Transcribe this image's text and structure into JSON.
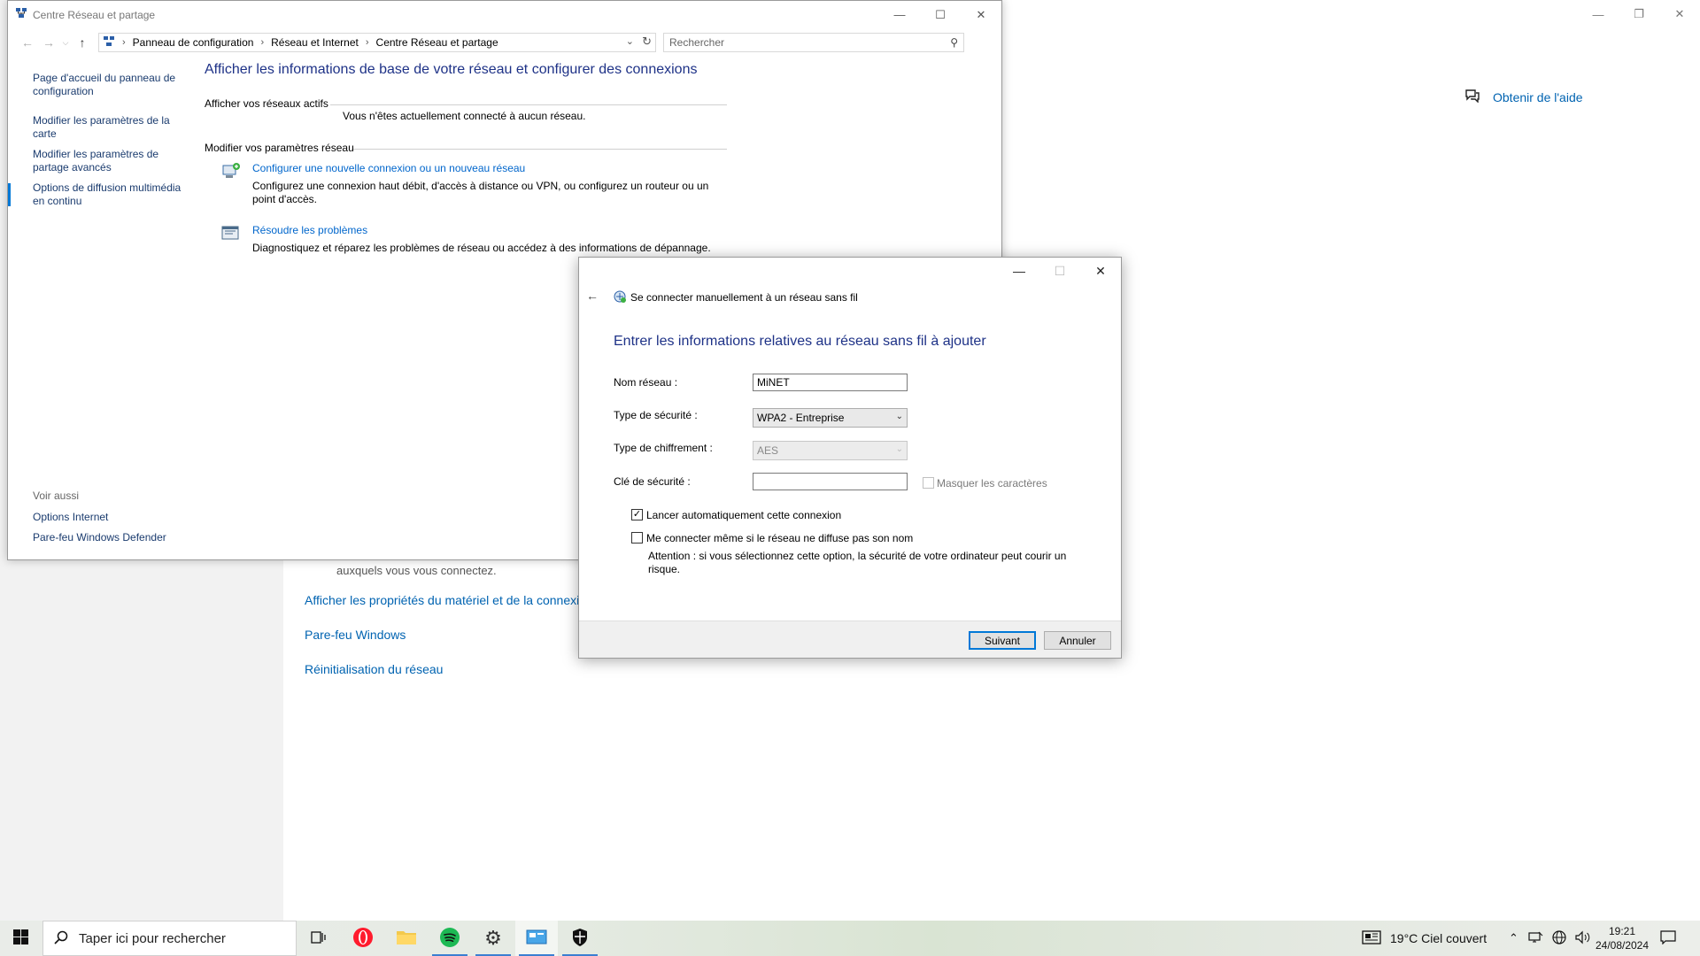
{
  "settings": {
    "help_label": "Obtenir de l'aide",
    "partial_text": "auxquels vous vous connectez.",
    "links": [
      "Afficher les propriétés du matériel et de la connexion",
      "Pare-feu Windows",
      "Réinitialisation du réseau"
    ]
  },
  "cp": {
    "title": "Centre Réseau et partage",
    "breadcrumb": [
      "Panneau de configuration",
      "Réseau et Internet",
      "Centre Réseau et partage"
    ],
    "search_placeholder": "Rechercher",
    "left_links": [
      "Page d'accueil du panneau de configuration",
      "Modifier les paramètres de la carte",
      "Modifier les paramètres de partage avancés",
      "Options de diffusion multimédia en continu"
    ],
    "see_also": "Voir aussi",
    "see_also_links": [
      "Options Internet",
      "Pare-feu Windows Defender"
    ],
    "main_title": "Afficher les informations de base de votre réseau et configurer des connexions",
    "active_networks": "Afficher vos réseaux actifs",
    "no_network": "Vous n'êtes actuellement connecté à aucun réseau.",
    "change_settings": "Modifier vos paramètres réseau",
    "tasks": [
      {
        "link": "Configurer une nouvelle connexion ou un nouveau réseau",
        "desc": "Configurez une connexion haut débit, d'accès à distance ou VPN, ou configurez un routeur ou un point d'accès."
      },
      {
        "link": "Résoudre les problèmes",
        "desc": "Diagnostiquez et réparez les problèmes de réseau ou accédez à des informations de dépannage."
      }
    ]
  },
  "dialog": {
    "header": "Se connecter manuellement à un réseau sans fil",
    "title": "Entrer les informations relatives au réseau sans fil à ajouter",
    "network_name_label": "Nom réseau :",
    "network_name_value": "MiNET",
    "security_type_label": "Type de sécurité :",
    "security_type_value": "WPA2 - Entreprise",
    "encryption_label": "Type de chiffrement :",
    "encryption_value": "AES",
    "key_label": "Clé de sécurité :",
    "key_value": "",
    "hide_chars_label": "Masquer les caractères",
    "auto_connect_label": "Lancer automatiquement cette connexion",
    "auto_connect_checked": true,
    "hidden_network_label": "Me connecter même si le réseau ne diffuse pas son nom",
    "hidden_network_checked": false,
    "warning": "Attention : si vous sélectionnez cette option, la sécurité de votre ordinateur peut courir un risque.",
    "next_button": "Suivant",
    "cancel_button": "Annuler"
  },
  "taskbar": {
    "search_placeholder": "Taper ici pour rechercher",
    "weather": "19°C  Ciel couvert",
    "time": "19:21",
    "date": "24/08/2024"
  },
  "colors": {
    "link_blue": "#0066cc",
    "title_blue": "#1e3287",
    "accent": "#0078d7"
  }
}
